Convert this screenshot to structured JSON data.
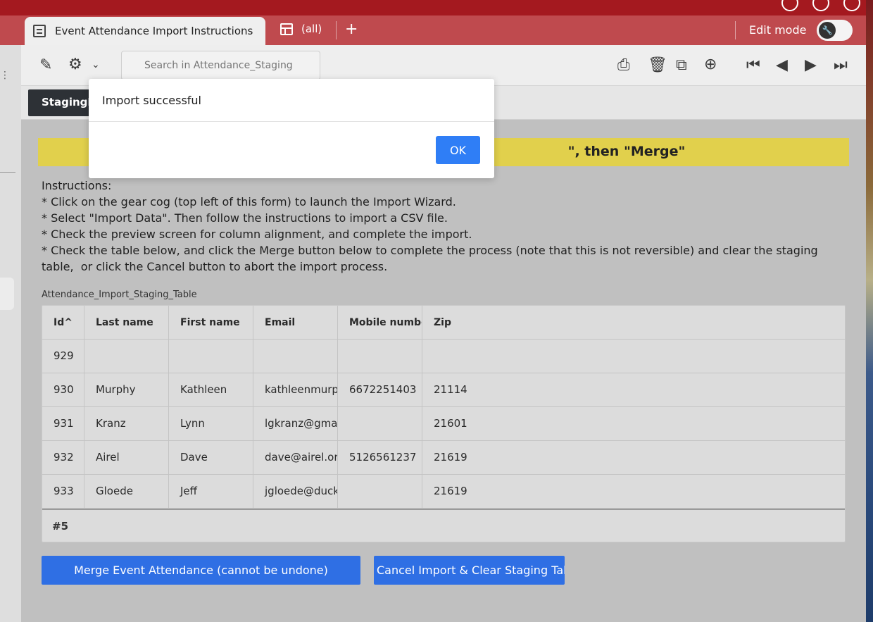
{
  "tabs": {
    "active_label": "Event Attendance Import Instructions",
    "all_label": "(all)",
    "add_label": "+",
    "edit_mode_label": "Edit mode"
  },
  "toolbar": {
    "search_placeholder": "Search in Attendance_Staging"
  },
  "subtab": {
    "label": "StagingIn"
  },
  "banner": {
    "text": "\", then \"Merge\""
  },
  "instructions": {
    "text": "Instructions:\n* Click on the gear cog (top left of this form) to launch the Import Wizard.\n* Select \"Import Data\". Then follow the instructions to import a CSV file.\n* Check the preview screen for column alignment, and complete the import.\n* Check the table below, and click the Merge button below to complete the process (note that this is not reversible) and clear the staging\ntable,  or click the Cancel button to abort the import process."
  },
  "table": {
    "label": "Attendance_Import_Staging_Table",
    "columns": [
      "Id^",
      "Last name",
      "First name",
      "Email",
      "Mobile number",
      "Zip"
    ],
    "rows": [
      [
        "929",
        "",
        "",
        "",
        "",
        ""
      ],
      [
        "930",
        "Murphy",
        "Kathleen",
        "kathleenmurphy",
        "6672251403",
        "21114"
      ],
      [
        "931",
        "Kranz",
        "Lynn",
        "lgkranz@gmail",
        "",
        "21601"
      ],
      [
        "932",
        "Airel",
        "Dave",
        "dave@airel.org",
        "5126561237",
        "21619"
      ],
      [
        "933",
        "Gloede",
        "Jeff",
        "jgloede@duck",
        "",
        "21619"
      ]
    ],
    "footer": "#5"
  },
  "buttons": {
    "merge_label": "Merge Event Attendance (cannot be undone)",
    "cancel_label": "Cancel Import & Clear Staging Table"
  },
  "modal": {
    "message": "Import successful",
    "ok_label": "OK"
  },
  "colors": {
    "brand_red": "#a4191f",
    "accent_blue": "#2f6fe4",
    "banner_yellow": "#e1d04c"
  }
}
